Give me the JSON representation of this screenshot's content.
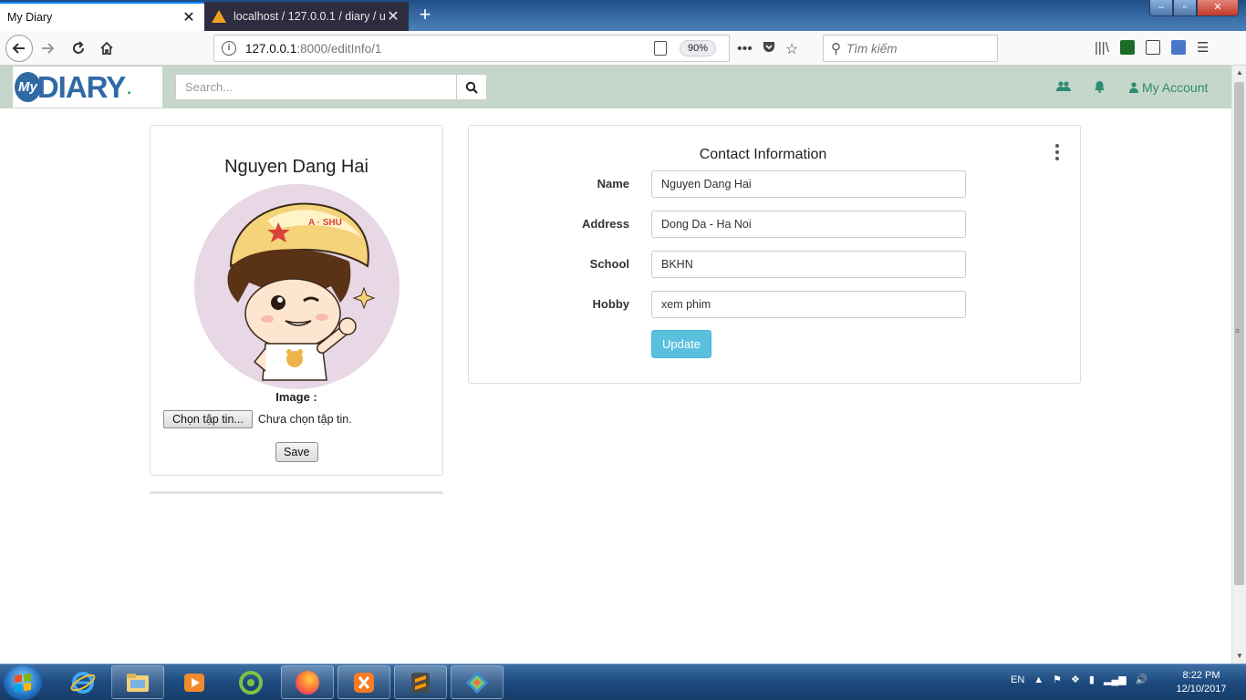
{
  "browser": {
    "tabs": [
      {
        "title": "My Diary",
        "active": true
      },
      {
        "title": "localhost / 127.0.0.1 / diary / us",
        "active": false
      }
    ],
    "url_host": "127.0.0.1",
    "url_rest": ":8000/editInfo/1",
    "zoom": "90%",
    "search_placeholder": "Tìm kiếm"
  },
  "site": {
    "logo_my": "My",
    "logo_diary": "DIARY",
    "search_placeholder": "Search...",
    "account_label": "My Account"
  },
  "profile": {
    "name": "Nguyen Dang Hai",
    "image_label": "Image :",
    "file_button": "Chọn tập tin...",
    "file_status": "Chưa chọn tập tin.",
    "save_label": "Save",
    "avatar_cap_text": "A · SHU"
  },
  "contact": {
    "title": "Contact Information",
    "fields": [
      {
        "label": "Name",
        "value": "Nguyen Dang Hai"
      },
      {
        "label": "Address",
        "value": "Dong Da - Ha Noi"
      },
      {
        "label": "School",
        "value": "BKHN"
      },
      {
        "label": "Hobby",
        "value": "xem phim"
      }
    ],
    "update_label": "Update"
  },
  "taskbar": {
    "language": "EN",
    "time": "8:22 PM",
    "date": "12/10/2017"
  },
  "colors": {
    "site_header_bg": "#c5d6cb",
    "accent_green": "#2f8b73",
    "logo_blue": "#2f6aa5",
    "update_button": "#5bc0de"
  }
}
